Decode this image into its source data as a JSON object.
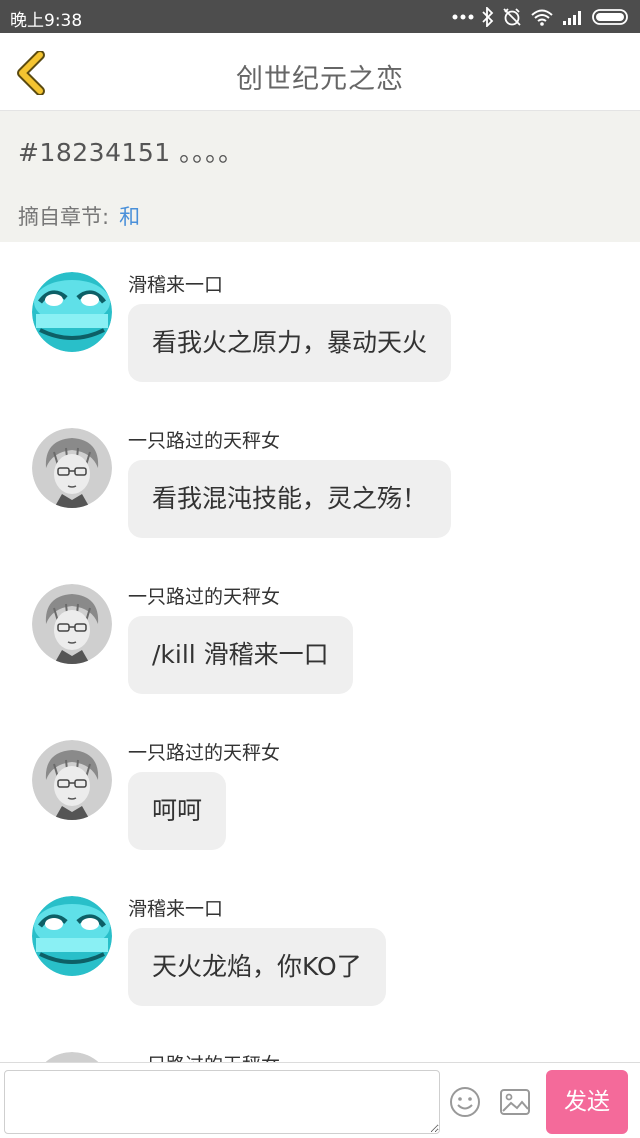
{
  "status_bar": {
    "time": "晚上9:38",
    "icons": [
      "more-dots-icon",
      "bluetooth-icon",
      "alarm-off-icon",
      "wifi-icon",
      "signal-icon",
      "battery-icon"
    ]
  },
  "header": {
    "title": "创世纪元之恋",
    "back_icon": "chevron-left-icon",
    "accent_color": "#f4c430"
  },
  "topic": {
    "text": "#18234151 。。。。",
    "chapter_label": "摘自章节:",
    "chapter_link": "和",
    "background": "#f2f2ee",
    "link_color": "#4a90d9"
  },
  "messages": [
    {
      "sender": "滑稽来一口",
      "text": "看我火之原力，暴动天火",
      "avatar": "funny-face-avatar"
    },
    {
      "sender": "一只路过的天秤女",
      "text": "看我混沌技能，灵之殇！",
      "avatar": "anime-boy-avatar"
    },
    {
      "sender": "一只路过的天秤女",
      "text": "/kill 滑稽来一口",
      "avatar": "anime-boy-avatar"
    },
    {
      "sender": "一只路过的天秤女",
      "text": "呵呵",
      "avatar": "anime-boy-avatar"
    },
    {
      "sender": "滑稽来一口",
      "text": "天火龙焰，你KO了",
      "avatar": "funny-face-avatar"
    },
    {
      "sender": "一只路过的天秤女",
      "text": "",
      "avatar": "anime-boy-avatar"
    }
  ],
  "input_bar": {
    "placeholder": "",
    "emoji_icon": "smiley-icon",
    "image_icon": "image-icon",
    "send_label": "发送",
    "send_color": "#f46a9a"
  }
}
